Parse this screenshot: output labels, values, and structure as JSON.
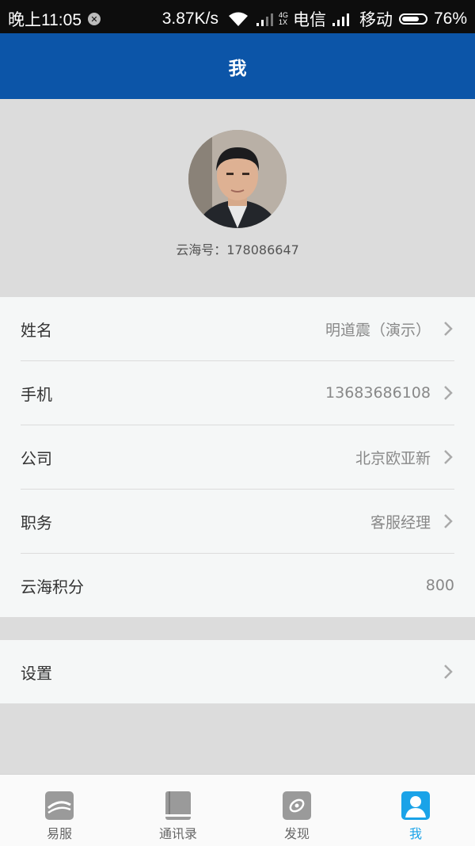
{
  "status_bar": {
    "time": "晚上11:05",
    "speed": "3.87K/s",
    "network_top": "4G",
    "network_bottom": "1X",
    "carrier1": "电信",
    "carrier2": "移动",
    "battery": "76%",
    "battery_level": 0.76
  },
  "header": {
    "title": "我"
  },
  "profile": {
    "id_label": "云海号：178086647"
  },
  "fields": [
    {
      "label": "姓名",
      "value": "明道震（演示）"
    },
    {
      "label": "手机",
      "value": "13683686108"
    },
    {
      "label": "公司",
      "value": "北京欧亚新"
    },
    {
      "label": "职务",
      "value": "客服经理"
    },
    {
      "label": "云海积分",
      "value": "800"
    }
  ],
  "settings": {
    "label": "设置"
  },
  "tabs": [
    {
      "label": "易服",
      "icon": "yifu-icon"
    },
    {
      "label": "通讯录",
      "icon": "contacts-book-icon"
    },
    {
      "label": "发现",
      "icon": "discover-icon"
    },
    {
      "label": "我",
      "icon": "user-profile-icon"
    }
  ],
  "colors": {
    "header": "#0c55a8",
    "active_tab": "#1aa3e8",
    "inactive_icon": "#9a9a9a"
  }
}
